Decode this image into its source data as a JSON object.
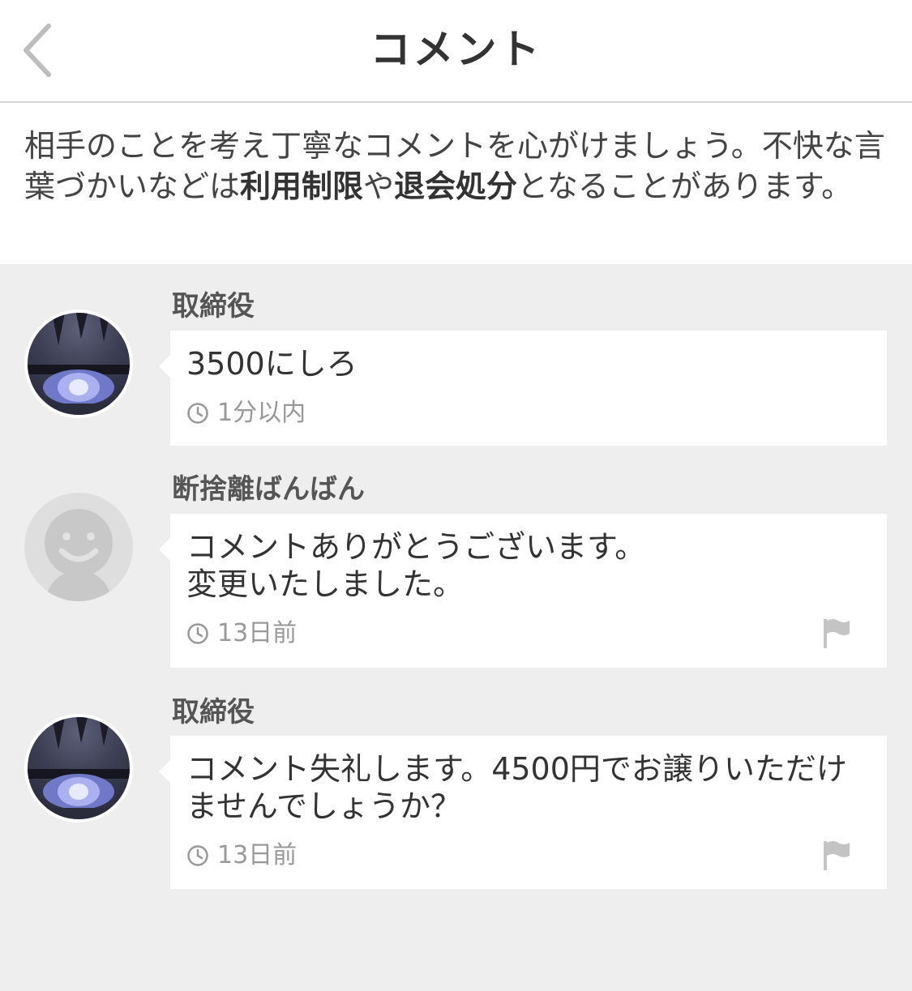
{
  "header": {
    "title": "コメント"
  },
  "notice": {
    "part1": "相手のことを考え丁寧なコメントを心がけましょう。不快な言葉づかいなどは",
    "bold1": "利用制限",
    "part2": "や",
    "bold2": "退会処分",
    "part3": "となることがあります。"
  },
  "comments": [
    {
      "name": "取締役",
      "text": "3500にしろ",
      "time": "1分以内",
      "avatar": "anime-eye-avatar",
      "has_flag": false
    },
    {
      "name": "断捨離ばんばん",
      "text": "コメントありがとうございます。\n変更いたしました。",
      "time": "13日前",
      "avatar": "default-user-avatar",
      "has_flag": true
    },
    {
      "name": "取締役",
      "text": "コメント失礼します。4500円でお譲りいただけませんでしょうか？",
      "time": "13日前",
      "avatar": "anime-eye-avatar",
      "has_flag": true
    }
  ],
  "colors": {
    "background": "#eeeeef",
    "card": "#ffffff",
    "muted_text": "#999999"
  }
}
